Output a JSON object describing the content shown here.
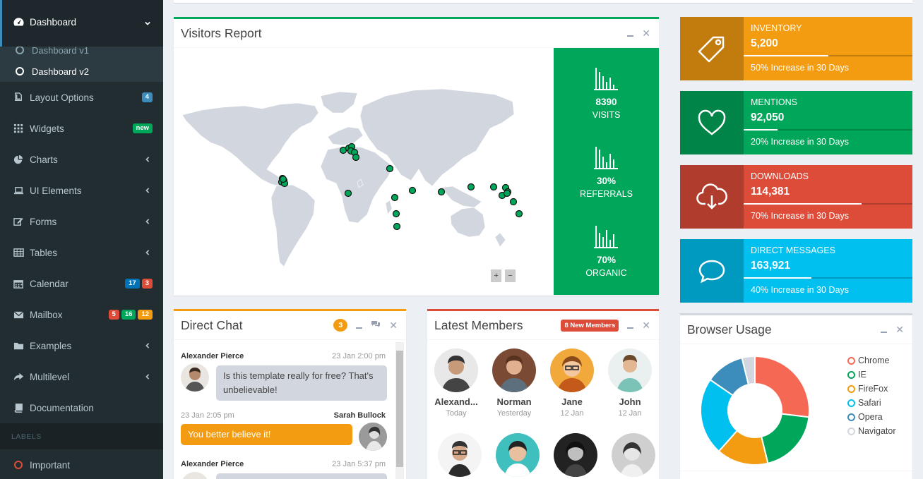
{
  "sidebar": {
    "dashboard": {
      "label": "Dashboard",
      "subitems": [
        "Dashboard v1",
        "Dashboard v2"
      ]
    },
    "items": [
      {
        "label": "Layout Options",
        "icon": "files-icon",
        "badges": [
          {
            "text": "4",
            "color": "#3c8dbc"
          }
        ]
      },
      {
        "label": "Widgets",
        "icon": "th-icon",
        "badges": [
          {
            "text": "new",
            "color": "#00a65a"
          }
        ]
      },
      {
        "label": "Charts",
        "icon": "pie-chart-icon"
      },
      {
        "label": "UI Elements",
        "icon": "laptop-icon"
      },
      {
        "label": "Forms",
        "icon": "edit-icon"
      },
      {
        "label": "Tables",
        "icon": "table-icon"
      },
      {
        "label": "Calendar",
        "icon": "calendar-icon",
        "badges": [
          {
            "text": "17",
            "color": "#0073b7"
          },
          {
            "text": "3",
            "color": "#dd4b39"
          }
        ]
      },
      {
        "label": "Mailbox",
        "icon": "envelope-icon",
        "badges": [
          {
            "text": "5",
            "color": "#dd4b39"
          },
          {
            "text": "16",
            "color": "#00a65a"
          },
          {
            "text": "12",
            "color": "#f39c12"
          }
        ]
      },
      {
        "label": "Examples",
        "icon": "folder-icon"
      },
      {
        "label": "Multilevel",
        "icon": "share-icon"
      },
      {
        "label": "Documentation",
        "icon": "book-icon"
      }
    ],
    "labels_header": "LABELS",
    "important": "Important"
  },
  "visitors": {
    "title": "Visitors Report",
    "stats": [
      {
        "value": "8390",
        "label": "VISITS"
      },
      {
        "value": "30%",
        "label": "REFERRALS"
      },
      {
        "value": "70%",
        "label": "ORGANIC"
      }
    ],
    "zoom_in": "+",
    "zoom_out": "−"
  },
  "info_boxes": [
    {
      "title": "INVENTORY",
      "value": "5,200",
      "progress": 0.5,
      "desc": "50% Increase in 30 Days",
      "color": "#f39c12",
      "icon": "tag-icon"
    },
    {
      "title": "MENTIONS",
      "value": "92,050",
      "progress": 0.2,
      "desc": "20% Increase in 30 Days",
      "color": "#00a65a",
      "icon": "heart-icon"
    },
    {
      "title": "DOWNLOADS",
      "value": "114,381",
      "progress": 0.7,
      "desc": "70% Increase in 30 Days",
      "color": "#dd4b39",
      "icon": "cloud-download-icon"
    },
    {
      "title": "DIRECT MESSAGES",
      "value": "163,921",
      "progress": 0.4,
      "desc": "40% Increase in 30 Days",
      "color": "#00c0ef",
      "icon": "comment-icon"
    }
  ],
  "chat": {
    "title": "Direct Chat",
    "badge": "3",
    "messages": [
      {
        "name": "Alexander Pierce",
        "time": "23 Jan 2:00 pm",
        "text": "Is this template really for free? That's unbelievable!",
        "side": "left"
      },
      {
        "name": "Sarah Bullock",
        "time": "23 Jan 2:05 pm",
        "text": "You better believe it!",
        "side": "right"
      },
      {
        "name": "Alexander Pierce",
        "time": "23 Jan 5:37 pm",
        "text": "",
        "side": "left"
      }
    ]
  },
  "members": {
    "title": "Latest Members",
    "badge": "8 New Members",
    "list": [
      {
        "name": "Alexand...",
        "date": "Today"
      },
      {
        "name": "Norman",
        "date": "Yesterday"
      },
      {
        "name": "Jane",
        "date": "12 Jan"
      },
      {
        "name": "John",
        "date": "12 Jan"
      }
    ]
  },
  "browser_usage": {
    "title": "Browser Usage"
  },
  "chart_data": {
    "type": "pie",
    "categories": [
      "Chrome",
      "IE",
      "FireFox",
      "Safari",
      "Opera",
      "Navigator"
    ],
    "values": [
      700,
      500,
      400,
      600,
      300,
      100
    ],
    "colors": [
      "#f56954",
      "#00a65a",
      "#f39c12",
      "#00c0ef",
      "#3c8dbc",
      "#d2d6de"
    ],
    "donut": true,
    "legend_position": "right"
  }
}
